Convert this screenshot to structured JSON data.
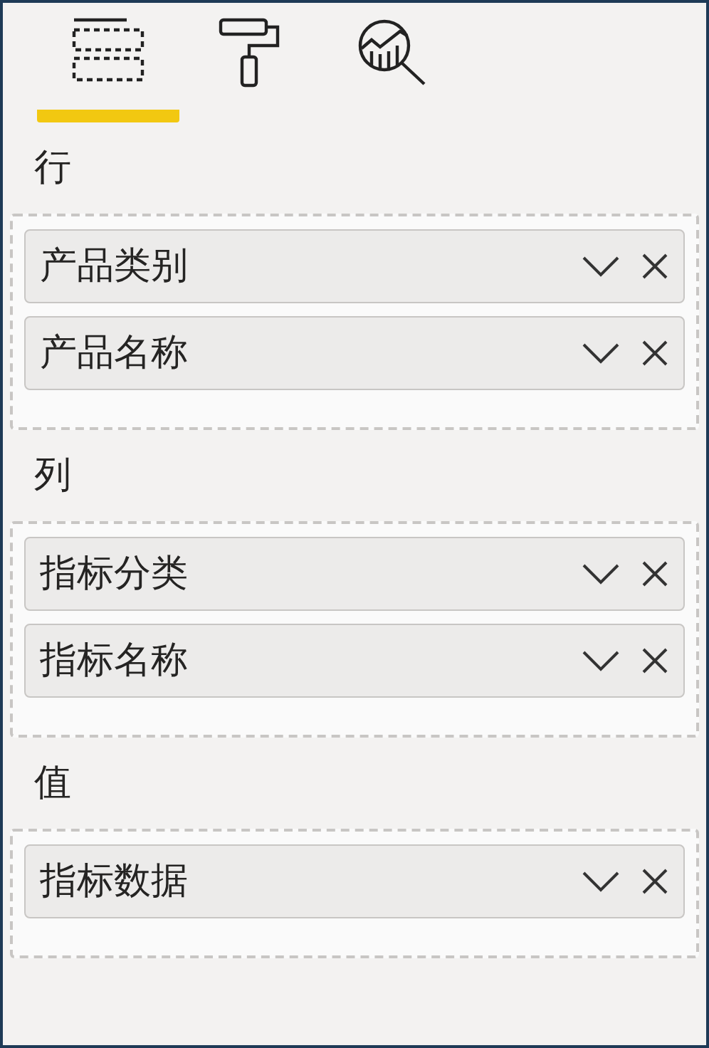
{
  "tabs": [
    {
      "kind": "fields",
      "selected": true
    },
    {
      "kind": "format",
      "selected": false
    },
    {
      "kind": "analytics",
      "selected": false
    }
  ],
  "sections": [
    {
      "title": "行",
      "fields": [
        {
          "label": "产品类别"
        },
        {
          "label": "产品名称"
        }
      ]
    },
    {
      "title": "列",
      "fields": [
        {
          "label": "指标分类"
        },
        {
          "label": "指标名称"
        }
      ]
    },
    {
      "title": "值",
      "fields": [
        {
          "label": "指标数据"
        }
      ]
    }
  ]
}
